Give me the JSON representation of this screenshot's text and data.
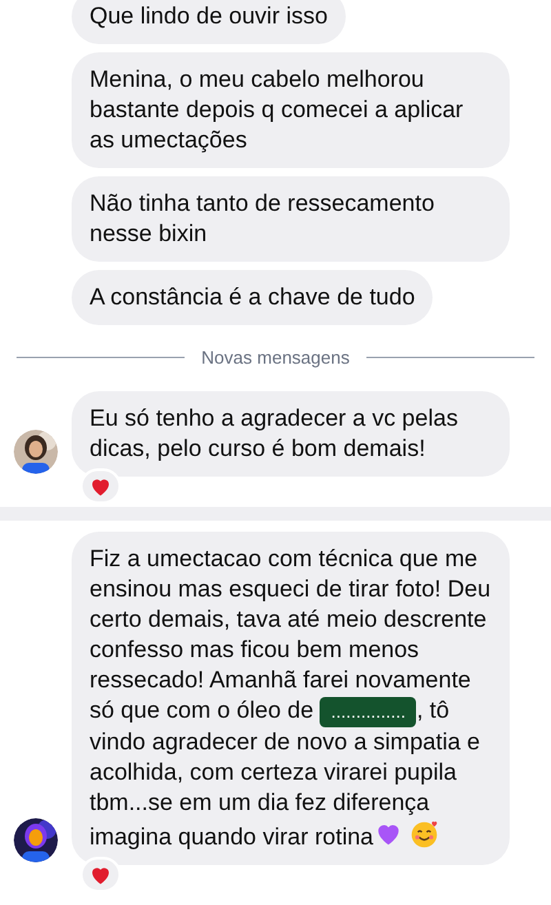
{
  "sections": [
    {
      "messages": [
        {
          "parts": [
            {
              "kind": "text",
              "text": "Que lindo de ouvir isso"
            }
          ],
          "avatar": false,
          "reacted": false
        },
        {
          "parts": [
            {
              "kind": "text",
              "text": "Menina, o meu cabelo melhorou bastante depois q comecei a aplicar as umectações"
            }
          ],
          "avatar": false,
          "reacted": false
        },
        {
          "parts": [
            {
              "kind": "text",
              "text": "Não tinha tanto de ressecamento nesse bixin"
            }
          ],
          "avatar": false,
          "reacted": false
        },
        {
          "parts": [
            {
              "kind": "text",
              "text": "A constância é a chave de tudo"
            }
          ],
          "avatar": false,
          "reacted": false
        },
        {
          "kind": "divider",
          "text": "Novas mensagens"
        },
        {
          "parts": [
            {
              "kind": "text",
              "text": "Eu só tenho a agradecer a vc pelas dicas, pelo curso é bom demais!"
            }
          ],
          "avatar": true,
          "reacted": true
        }
      ]
    },
    {
      "messages": [
        {
          "parts": [
            {
              "kind": "text",
              "text": "Fiz a umectacao com técnica que me ensinou mas esqueci de tirar foto! Deu certo demais, tava até meio descrente confesso mas ficou bem menos ressecado! Amanhã farei novamente só que com o óleo de "
            },
            {
              "kind": "redacted",
              "text": "..............."
            },
            {
              "kind": "text",
              "text": ", tô vindo agradecer de novo a simpatia e acolhida, com certeza virarei pupila tbm...se em um dia fez diferença imagina quando virar rotina"
            },
            {
              "kind": "heart"
            },
            {
              "kind": "smile"
            }
          ],
          "avatar": true,
          "reacted": true
        }
      ]
    }
  ]
}
